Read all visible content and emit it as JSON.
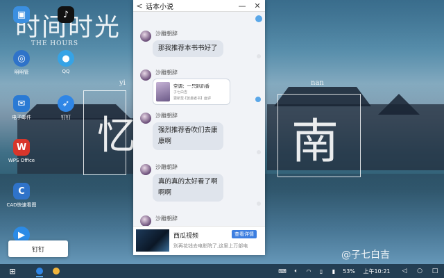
{
  "desktop": {
    "calligraphy_top": "时间时光",
    "calligraphy_sub": "THE HOURS",
    "char_left": "忆",
    "char_right": "南",
    "pinyin_left": "yi",
    "pinyin_right": "nan",
    "watermark": "@子七白吉",
    "icons": [
      {
        "name": "file-manager",
        "label": "",
        "color": "#3b8fe0",
        "glyph": "▣"
      },
      {
        "name": "tiktok",
        "label": "",
        "color": "#111111",
        "glyph": "♪"
      },
      {
        "name": "dribbble",
        "label": "明明管",
        "color": "#2f73c9",
        "glyph": "◎"
      },
      {
        "name": "qq",
        "label": "QQ",
        "color": "#36a3e6",
        "glyph": "●"
      },
      {
        "name": "email",
        "label": "电子邮件",
        "color": "#2a7ad4",
        "glyph": "✉"
      },
      {
        "name": "dingtalk",
        "label": "钉钉",
        "color": "#2f86e6",
        "glyph": "➶"
      },
      {
        "name": "wps",
        "label": "WPS Office",
        "color": "#d8362b",
        "glyph": "W"
      },
      {
        "name": "cad",
        "label": "CAD快速看图",
        "color": "#2f73c9",
        "glyph": "C"
      },
      {
        "name": "player",
        "label": "",
        "color": "#2c8be6",
        "glyph": "▶"
      }
    ]
  },
  "tooltip": {
    "label": "钉钉"
  },
  "chat": {
    "title": "话本小说",
    "back": "<",
    "minimize": "—",
    "close": "✕",
    "messages": [
      {
        "sender": "沙雕朝辞",
        "text": "那我推荐本书书好了"
      },
      {
        "sender": "沙雕朝辞",
        "card": {
          "title": "空调：一只趴趴香",
          "meta1": "子七白吉",
          "meta2": "更新至·【苦最者书】面评"
        }
      },
      {
        "sender": "沙雕朝辞",
        "lines": [
          "强烈推荐香吹们去康",
          "康啊"
        ]
      },
      {
        "sender": "沙雕朝辞",
        "lines": [
          "真的真的太好看了啊",
          "啊啊"
        ]
      },
      {
        "sender": "沙雕朝辞",
        "text": ""
      }
    ],
    "ad": {
      "title": "西瓜视频",
      "button": "查看详情",
      "desc": "別再花钱去电影院了,这里上万部电"
    }
  },
  "taskbar": {
    "battery": "53%",
    "time": "上午10:21"
  }
}
